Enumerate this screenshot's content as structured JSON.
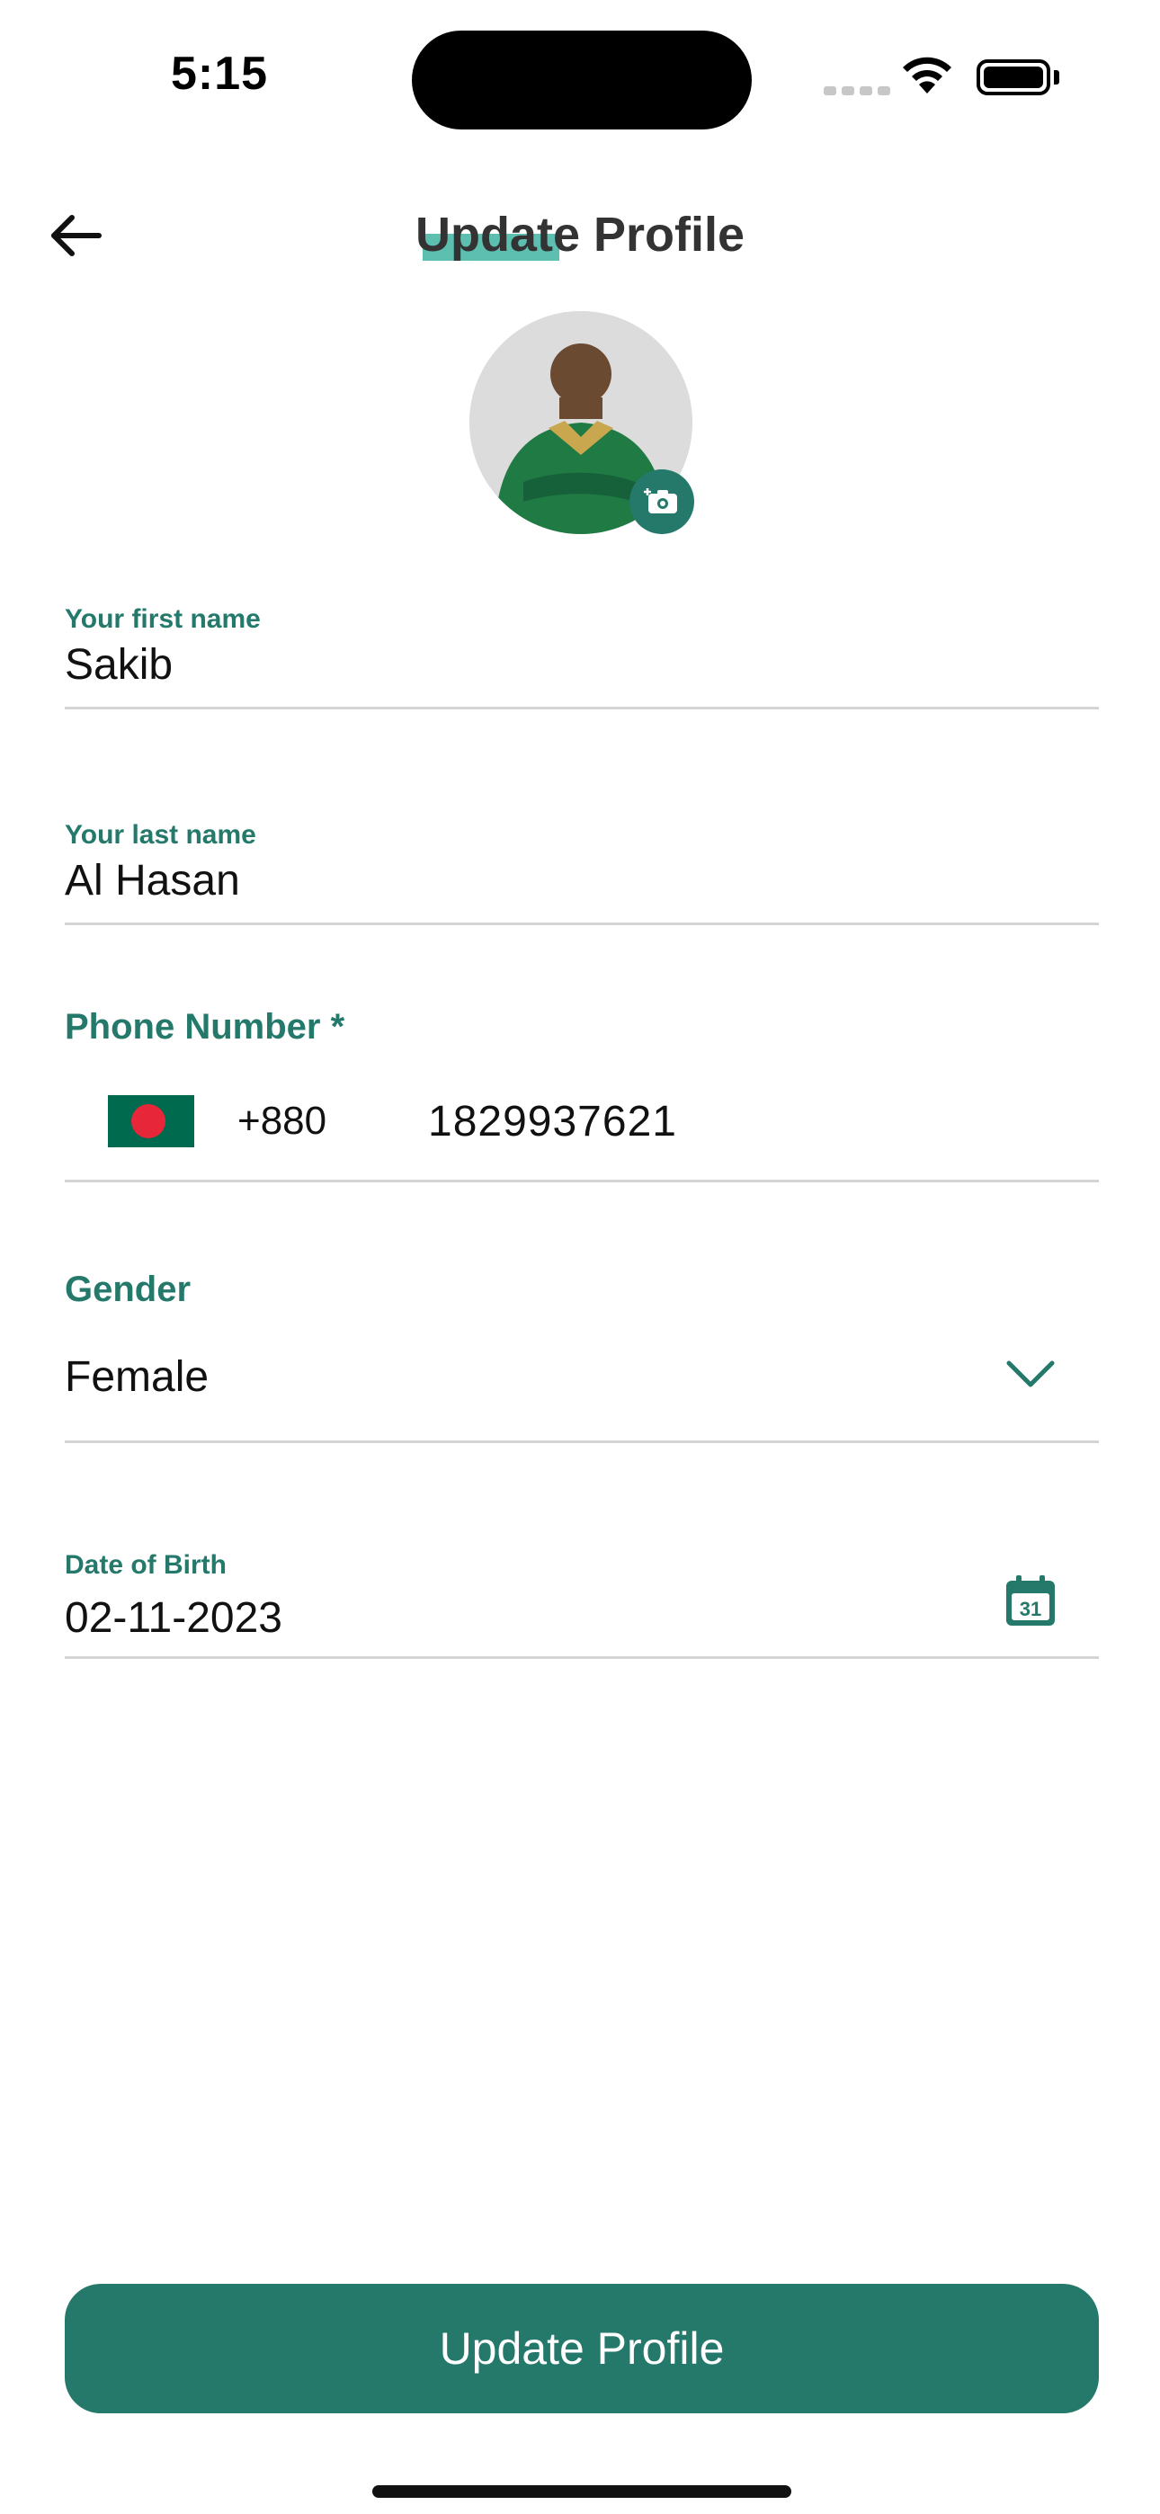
{
  "status_bar": {
    "time": "5:15"
  },
  "header": {
    "title": "Update Profile"
  },
  "icons": {
    "back": "back-arrow-icon",
    "camera": "camera-add-icon",
    "chevron": "chevron-down-icon",
    "calendar": "calendar-icon"
  },
  "form": {
    "first_name": {
      "label": "Your first name",
      "value": "Sakib"
    },
    "last_name": {
      "label": "Your last name",
      "value": "Al Hasan"
    },
    "phone": {
      "label": "Phone Number *",
      "country_code": "+880",
      "value": "1829937621"
    },
    "gender": {
      "label": "Gender",
      "value": "Female"
    },
    "dob": {
      "label": "Date of Birth",
      "value": "02-11-2023",
      "calendar_day": "31"
    }
  },
  "actions": {
    "update_label": "Update Profile"
  },
  "colors": {
    "primary": "#24796b",
    "accent": "#5cbfb0"
  }
}
